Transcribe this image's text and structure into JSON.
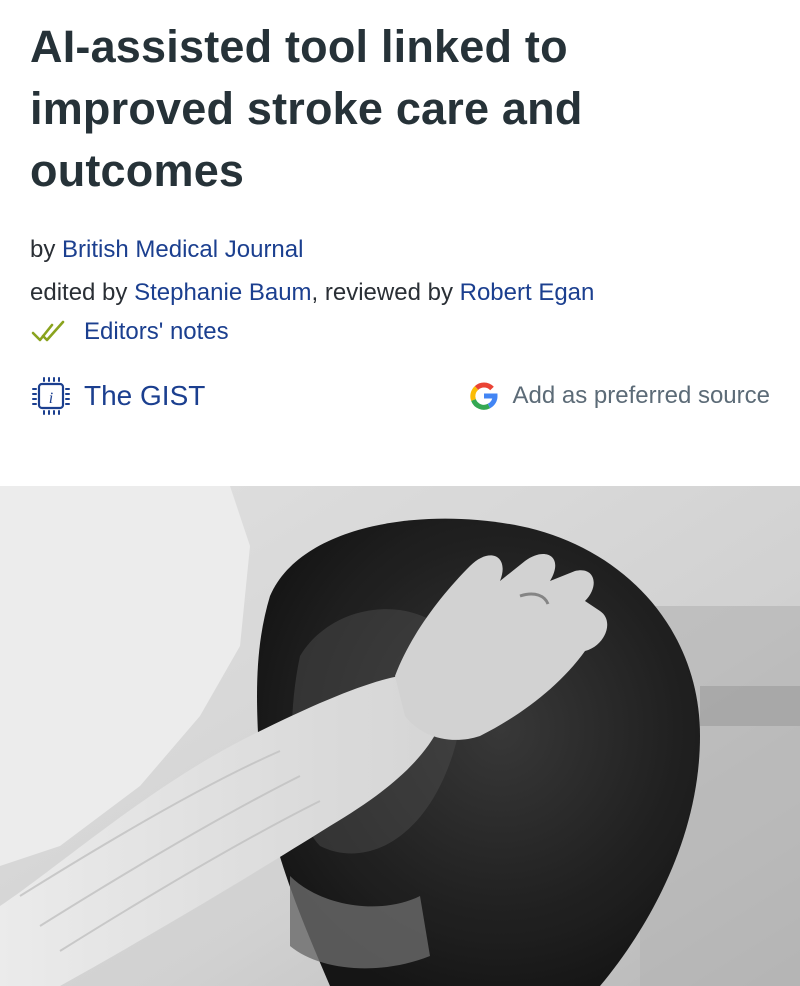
{
  "article": {
    "title": "AI-assisted tool linked to improved stroke care and outcomes",
    "byline_prefix": "by",
    "publisher": "British Medical Journal",
    "edited_prefix": "edited by",
    "editor": "Stephanie Baum",
    "reviewed_prefix": ", reviewed by",
    "reviewer": "Robert Egan"
  },
  "actions": {
    "editors_notes_label": "Editors' notes",
    "gist_label": "The GIST",
    "preferred_source_label": "Add as preferred source"
  },
  "icons": {
    "editors_notes": "double-check-icon",
    "gist": "info-chip-icon",
    "preferred_source": "google-g-icon"
  },
  "colors": {
    "title": "#263238",
    "link": "#1b3f8f",
    "muted": "#5c6b77",
    "check_green": "#8aa31e"
  },
  "hero_image": {
    "description": "black and white photo of a person holding another's head"
  }
}
